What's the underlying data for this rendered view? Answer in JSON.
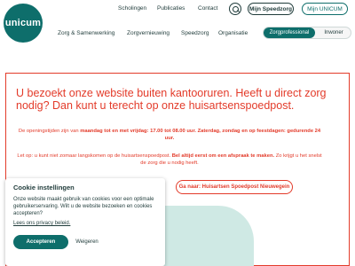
{
  "logo": {
    "text": "unicum"
  },
  "toplinks": {
    "scholingen": "Scholingen",
    "publicaties": "Publicaties",
    "contact": "Contact"
  },
  "buttons": {
    "mijn_speedzorg": "Mijn Speedzorg",
    "mijn_unicum": "Mijn UNICUM"
  },
  "nav": {
    "zorg_samenwerking": "Zorg & Samenwerking",
    "zorgvernieuwing": "Zorgvernieuwing",
    "speedzorg": "Speedzorg",
    "organisatie": "Organisatie"
  },
  "audience_toggle": {
    "active": "Zorgprofessional",
    "inactive": "Inwoner"
  },
  "alert": {
    "title": "U bezoekt onze website buiten kantooruren. Heeft u direct zorg nodig? Dan kunt u terecht op onze huisartsenspoedpost.",
    "hours_prefix": "De openingstijden zijn van",
    "hours_bold": "maandag tot en met vrijdag: 17.00 tot 08.00 uur. Zaterdag, zondag en op feestdagen: gedurende 24 uur.",
    "walkin_prefix": "Let op: u kunt niet zomaar langskomen op de huisartsenspoedpost.",
    "walkin_bold": "Bel altijd eerst om een afspraak te maken.",
    "walkin_suffix": "Zo krijgt u het snelst de zorg die u nodig heeft.",
    "link_button": "Ga naar: Huisartsen Spoedpost Nieuwegein"
  },
  "cookie": {
    "title": "Cookie instellingen",
    "body": "Onze website maakt gebruik van cookies voor een optimale gebruikerservaring. Wilt u de website bezoeken en cookies accepteren?",
    "privacy_link": "Lees ons privacy beleid.",
    "accept": "Accepteren",
    "reject": "Weigeren"
  },
  "colors": {
    "brand": "#0e6e6b",
    "alert": "#e33b2a",
    "mint": "#cfe9e4"
  }
}
